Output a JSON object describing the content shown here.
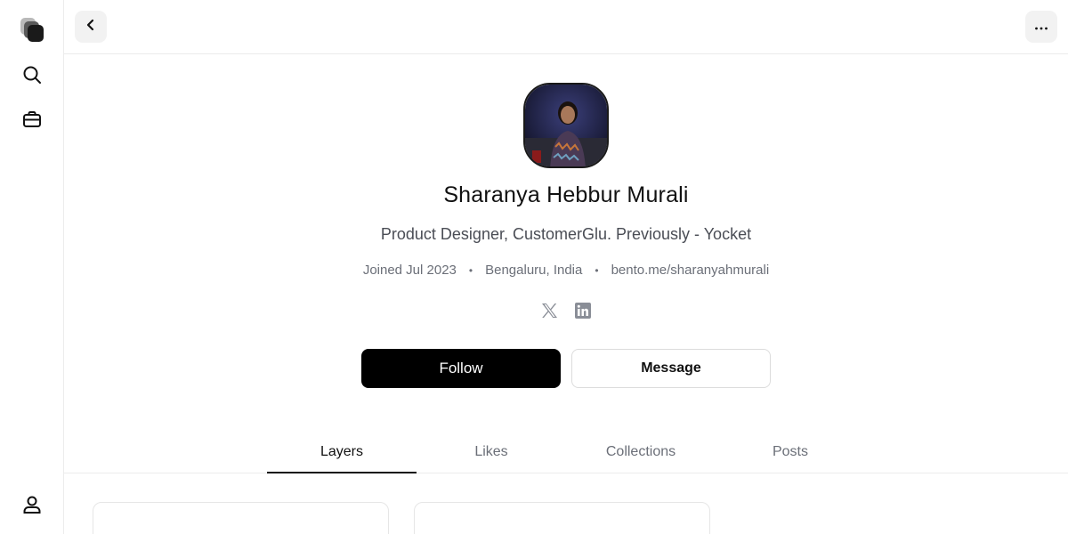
{
  "sidebar": {
    "items": [
      {
        "icon": "layers-logo-icon"
      },
      {
        "icon": "search-icon"
      },
      {
        "icon": "briefcase-icon"
      },
      {
        "icon": "user-icon"
      }
    ]
  },
  "topbar": {
    "back_icon": "chevron-left-icon",
    "more_icon": "ellipsis-icon"
  },
  "profile": {
    "name": "Sharanya Hebbur Murali",
    "bio": "Product Designer, CustomerGlu. Previously - Yocket",
    "joined": "Joined Jul 2023",
    "location": "Bengaluru, India",
    "website": "bento.me/sharanyahmurali",
    "separator": "•",
    "socials": [
      "x-icon",
      "linkedin-icon"
    ],
    "follow_label": "Follow",
    "message_label": "Message"
  },
  "tabs": [
    {
      "label": "Layers",
      "active": true
    },
    {
      "label": "Likes",
      "active": false
    },
    {
      "label": "Collections",
      "active": false
    },
    {
      "label": "Posts",
      "active": false
    }
  ],
  "colors": {
    "primary": "#000000",
    "muted_text": "#6b6f78",
    "border": "#ececec"
  }
}
